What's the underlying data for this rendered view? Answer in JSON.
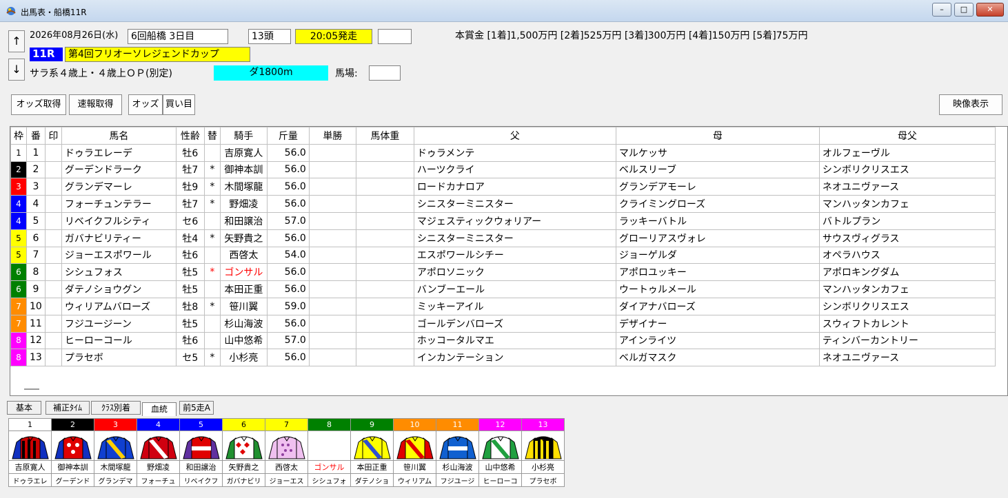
{
  "window": {
    "title": "出馬表・船橋11R",
    "min_label": "–",
    "max_label": "□",
    "close_label": "✕"
  },
  "race": {
    "date": "2026年08月26日(水)",
    "meeting": "6回船橋 3日目",
    "count": "13頭",
    "post_time": "20:05発走",
    "extra": "",
    "race_no": "11R",
    "name": "第4回フリオーソレジェンドカップ",
    "conditions": "サラ系４歳上・４歳上ＯＰ(別定)",
    "course": "ダ1800m",
    "track_label": "馬場:",
    "track_value": "",
    "prize": "本賞金 [1着]1,500万円 [2着]525万円 [3着]300万円 [4着]150万円 [5着]75万円"
  },
  "nav": {
    "up": "↑",
    "down": "↓"
  },
  "toolbar": {
    "odds_get": "オッズ取得",
    "flash_get": "速報取得",
    "odds": "オッズ",
    "bets": "買い目",
    "video": "映像表示"
  },
  "columns": [
    "枠",
    "番",
    "印",
    "馬名",
    "性齢",
    "替",
    "騎手",
    "斤量",
    "単勝",
    "馬体重",
    "父",
    "母",
    "母父"
  ],
  "colors": {
    "w1": "#ffffff",
    "w2": "#000000",
    "w3": "#ff0000",
    "w4": "#0000ff",
    "w5": "#ffff00",
    "w6": "#008000",
    "w7": "#ff8c00",
    "w8": "#ff00ff",
    "highlight_yellow": "#ffff00",
    "highlight_cyan": "#00ffff",
    "race_blue": "#0000ff",
    "red_text": "#ff0000"
  },
  "horses": [
    {
      "waku": "1",
      "num": "1",
      "mark": "",
      "name": "ドゥラエレーデ",
      "sexage": "牡6",
      "change": "",
      "jockey": "吉原寛人",
      "weight": "56.0",
      "win": "",
      "bw": "",
      "sire": "ドゥラメンテ",
      "dam": "マルケッサ",
      "damsire": "オルフェーヴル"
    },
    {
      "waku": "2",
      "num": "2",
      "mark": "",
      "name": "グーデンドラーク",
      "sexage": "牡7",
      "change": "*",
      "jockey": "御神本訓",
      "weight": "56.0",
      "win": "",
      "bw": "",
      "sire": "ハーツクライ",
      "dam": "ベルスリーブ",
      "damsire": "シンボリクリスエス"
    },
    {
      "waku": "3",
      "num": "3",
      "mark": "",
      "name": "グランデマーレ",
      "sexage": "牡9",
      "change": "*",
      "jockey": "木間塚龍",
      "weight": "56.0",
      "win": "",
      "bw": "",
      "sire": "ロードカナロア",
      "dam": "グランデアモーレ",
      "damsire": "ネオユニヴァース"
    },
    {
      "waku": "4",
      "num": "4",
      "mark": "",
      "name": "フォーチュンテラー",
      "sexage": "牡7",
      "change": "*",
      "jockey": "野畑凌",
      "weight": "56.0",
      "win": "",
      "bw": "",
      "sire": "シニスターミニスター",
      "dam": "クライミングローズ",
      "damsire": "マンハッタンカフェ"
    },
    {
      "waku": "4",
      "num": "5",
      "mark": "",
      "name": "リベイクフルシティ",
      "sexage": "セ6",
      "change": "",
      "jockey": "和田譲治",
      "weight": "57.0",
      "win": "",
      "bw": "",
      "sire": "マジェスティックウォリアー",
      "dam": "ラッキーバトル",
      "damsire": "バトルプラン"
    },
    {
      "waku": "5",
      "num": "6",
      "mark": "",
      "name": "ガバナビリティー",
      "sexage": "牡4",
      "change": "*",
      "jockey": "矢野貴之",
      "weight": "56.0",
      "win": "",
      "bw": "",
      "sire": "シニスターミニスター",
      "dam": "グローリアスヴォレ",
      "damsire": "サウスヴィグラス"
    },
    {
      "waku": "5",
      "num": "7",
      "mark": "",
      "name": "ジョーエスポワール",
      "sexage": "牡6",
      "change": "",
      "jockey": "西啓太",
      "weight": "54.0",
      "win": "",
      "bw": "",
      "sire": "エスポワールシチー",
      "dam": "ジョーゲルダ",
      "damsire": "オペラハウス"
    },
    {
      "waku": "6",
      "num": "8",
      "mark": "",
      "name": "シシュフォス",
      "sexage": "牡5",
      "change": "*",
      "jockey": "ゴンサル",
      "weight": "56.0",
      "win": "",
      "bw": "",
      "sire": "アポロソニック",
      "dam": "アポロユッキー",
      "damsire": "アポロキングダム",
      "red": true
    },
    {
      "waku": "6",
      "num": "9",
      "mark": "",
      "name": "ダテノショウグン",
      "sexage": "牡5",
      "change": "",
      "jockey": "本田正重",
      "weight": "56.0",
      "win": "",
      "bw": "",
      "sire": "バンブーエール",
      "dam": "ウートゥルメール",
      "damsire": "マンハッタンカフェ"
    },
    {
      "waku": "7",
      "num": "10",
      "mark": "",
      "name": "ウィリアムバローズ",
      "sexage": "牡8",
      "change": "*",
      "jockey": "笹川翼",
      "weight": "59.0",
      "win": "",
      "bw": "",
      "sire": "ミッキーアイル",
      "dam": "ダイアナバローズ",
      "damsire": "シンボリクリスエス"
    },
    {
      "waku": "7",
      "num": "11",
      "mark": "",
      "name": "フジユージーン",
      "sexage": "牡5",
      "change": "",
      "jockey": "杉山海波",
      "weight": "56.0",
      "win": "",
      "bw": "",
      "sire": "ゴールデンバローズ",
      "dam": "デザイナー",
      "damsire": "スウィフトカレント"
    },
    {
      "waku": "8",
      "num": "12",
      "mark": "",
      "name": "ヒーローコール",
      "sexage": "牡6",
      "change": "",
      "jockey": "山中悠希",
      "weight": "57.0",
      "win": "",
      "bw": "",
      "sire": "ホッコータルマエ",
      "dam": "アインライツ",
      "damsire": "ティンバーカントリー"
    },
    {
      "waku": "8",
      "num": "13",
      "mark": "",
      "name": "プラセボ",
      "sexage": "セ5",
      "change": "*",
      "jockey": "小杉亮",
      "weight": "56.0",
      "win": "",
      "bw": "",
      "sire": "インカンテーション",
      "dam": "ベルガマスク",
      "damsire": "ネオユニヴァース"
    }
  ],
  "tabs": [
    "基本",
    "補正ﾀｲﾑ",
    "ｸﾗｽ別着",
    "血統",
    "前5走A"
  ],
  "active_tab": "血統",
  "silks": [
    {
      "num": "1",
      "color": "#ffffff",
      "text": "#000000",
      "jockey": "吉原寛人",
      "horse": "ドゥラエレ"
    },
    {
      "num": "2",
      "color": "#000000",
      "text": "#ffffff",
      "jockey": "御神本訓",
      "horse": "グーデンド"
    },
    {
      "num": "3",
      "color": "#ff0000",
      "text": "#ffffff",
      "jockey": "木間塚龍",
      "horse": "グランデマ"
    },
    {
      "num": "4",
      "color": "#0000ff",
      "text": "#ffffff",
      "jockey": "野畑凌",
      "horse": "フォーチュ"
    },
    {
      "num": "5",
      "color": "#0000ff",
      "text": "#ffffff",
      "jockey": "和田譲治",
      "horse": "リベイクフ"
    },
    {
      "num": "6",
      "color": "#ffff00",
      "text": "#000000",
      "jockey": "矢野貴之",
      "horse": "ガバナビリ"
    },
    {
      "num": "7",
      "color": "#ffff00",
      "text": "#000000",
      "jockey": "西啓太",
      "horse": "ジョーエス"
    },
    {
      "num": "8",
      "color": "#008000",
      "text": "#ffffff",
      "jockey": "ゴンサル",
      "horse": "シシュフォ"
    },
    {
      "num": "9",
      "color": "#008000",
      "text": "#ffffff",
      "jockey": "本田正重",
      "horse": "ダテノショ"
    },
    {
      "num": "10",
      "color": "#ff8c00",
      "text": "#ffffff",
      "jockey": "笹川翼",
      "horse": "ウィリアム"
    },
    {
      "num": "11",
      "color": "#ff8c00",
      "text": "#ffffff",
      "jockey": "杉山海波",
      "horse": "フジユージ"
    },
    {
      "num": "12",
      "color": "#ff00ff",
      "text": "#ffffff",
      "jockey": "山中悠希",
      "horse": "ヒーローコ"
    },
    {
      "num": "13",
      "color": "#ff00ff",
      "text": "#ffffff",
      "jockey": "小杉亮",
      "horse": "プラセボ"
    }
  ],
  "silk_designs": [
    {
      "body": "#cc0000",
      "stripe": "#000000",
      "sleeve": "#1030c0",
      "pattern": "vstripe"
    },
    {
      "body": "#e00000",
      "stripe": "#ffffff",
      "sleeve": "#1030c0",
      "pattern": "stars"
    },
    {
      "body": "#1040d0",
      "stripe": "#ffd000",
      "sleeve": "#1040d0",
      "pattern": "sash"
    },
    {
      "body": "#d00010",
      "stripe": "#ffffff",
      "sleeve": "#d00010",
      "pattern": "sash"
    },
    {
      "body": "#e00000",
      "stripe": "#ffffff",
      "sleeve": "#6030a0",
      "pattern": "hoop"
    },
    {
      "body": "#ffffff",
      "stripe": "#e00000",
      "sleeve": "#209030",
      "pattern": "diamond"
    },
    {
      "body": "#f0c0f0",
      "stripe": "#9040a0",
      "sleeve": "#f0c0f0",
      "pattern": "dots"
    },
    {
      "body": "",
      "stripe": "",
      "sleeve": "",
      "pattern": "none"
    },
    {
      "body": "#ffff00",
      "stripe": "#3050d0",
      "sleeve": "#ffff00",
      "pattern": "sash"
    },
    {
      "body": "#ffff00",
      "stripe": "#e00000",
      "sleeve": "#e00000",
      "pattern": "sash"
    },
    {
      "body": "#1060d0",
      "stripe": "#ffffff",
      "sleeve": "#1060d0",
      "pattern": "hoop"
    },
    {
      "body": "#ffffff",
      "stripe": "#20a040",
      "sleeve": "#20a040",
      "pattern": "sash"
    },
    {
      "body": "#000000",
      "stripe": "#ffe000",
      "sleeve": "#ffe000",
      "pattern": "vstripe"
    }
  ]
}
